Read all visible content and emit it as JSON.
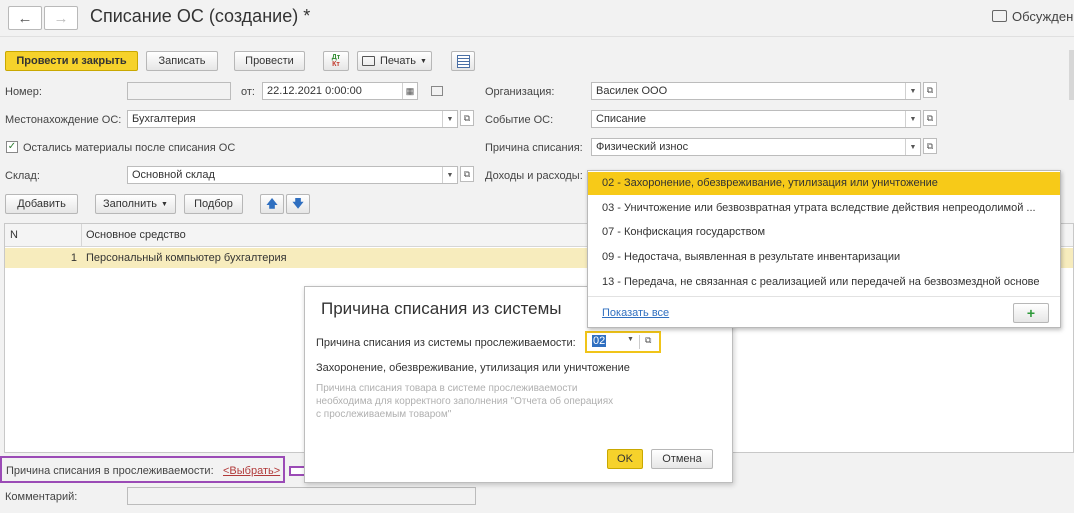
{
  "header": {
    "title": "Списание ОС (создание) *",
    "discuss_label": "Обсужден"
  },
  "toolbar": {
    "post_close": "Провести и закрыть",
    "save": "Записать",
    "post": "Провести",
    "dtkt": "Дт Кт",
    "print": "Печать"
  },
  "form": {
    "number_label": "Номер:",
    "number_value": "",
    "date_label": "от:",
    "date_value": "22.12.2021  0:00:00",
    "location_label": "Местонахождение ОС:",
    "location_value": "Бухгалтерия",
    "materials_label": "Остались материалы после списания ОС",
    "warehouse_label": "Склад:",
    "warehouse_value": "Основной склад",
    "org_label": "Организация:",
    "org_value": "Василек ООО",
    "event_label": "Событие ОС:",
    "event_value": "Списание",
    "reason_label": "Причина списания:",
    "reason_value": "Физический износ",
    "income_label": "Доходы и расходы:"
  },
  "table_toolbar": {
    "add": "Добавить",
    "fill": "Заполнить",
    "select": "Подбор"
  },
  "table": {
    "columns": [
      "N",
      "Основное средство"
    ],
    "rows": [
      {
        "n": "1",
        "asset": "Персональный компьютер бухгалтерия"
      }
    ]
  },
  "bottom": {
    "tracking_reason_label": "Причина списания в прослеживаемости:",
    "tracking_reason_link": "<Выбрать>",
    "comment_label": "Комментарий:",
    "comment_value": ""
  },
  "dropdown": {
    "items": [
      "02 - Захоронение, обезвреживание, утилизация или уничтожение",
      "03 - Уничтожение или безвозвратная утрата вследствие действия непреодолимой ...",
      "07 - Конфискация государством",
      "09 - Недостача, выявленная в результате инвентаризации",
      "13 - Передача, не связанная с реализацией или передачей на безвозмездной основе"
    ],
    "show_all": "Показать все",
    "add_icon": "+"
  },
  "dialog": {
    "title": "Причина списания из системы",
    "field_label": "Причина списания из системы прослеживаемости:",
    "field_value": "02",
    "description": "Захоронение, обезвреживание, утилизация или уничтожение",
    "hint": "Причина списания товара в системе прослеживаемости необходима для корректного заполнения \"Отчета об операциях с прослеживаемым товаром\"",
    "ok": "OK",
    "cancel": "Отмена"
  },
  "colors": {
    "primary_button": "#f6d22b",
    "selected_item": "#f7ca18",
    "row_highlight": "#f7ecbd",
    "annotation_frame": "#9b4bb6"
  }
}
